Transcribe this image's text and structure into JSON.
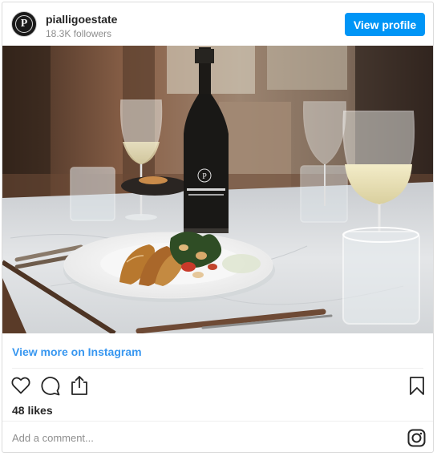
{
  "account": {
    "username": "pialligoestate",
    "followers": "18.3K followers",
    "avatar_letter": "P"
  },
  "header": {
    "view_profile_label": "View profile"
  },
  "post": {
    "image_icon": "food-and-wine-photo",
    "view_more_label": "View more on Instagram",
    "likes": "48 likes"
  },
  "actions": {
    "like_icon": "heart-icon",
    "comment_icon": "speech-bubble-icon",
    "share_icon": "share-icon",
    "save_icon": "bookmark-icon"
  },
  "comment": {
    "placeholder": "Add a comment..."
  },
  "footer": {
    "logo_icon": "instagram-icon"
  },
  "colors": {
    "accent": "#0095f6",
    "link": "#3897f0",
    "text": "#262626",
    "muted": "#8e8e8e"
  }
}
